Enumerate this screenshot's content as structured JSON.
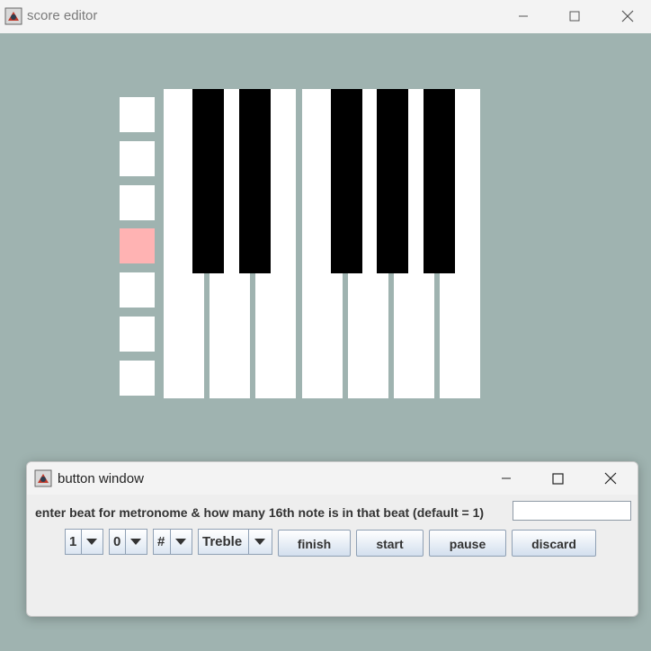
{
  "main_window": {
    "title": "score editor",
    "controls": [
      "minimize",
      "maximize",
      "close"
    ]
  },
  "editor": {
    "note_rows": [
      {
        "active": false
      },
      {
        "active": false
      },
      {
        "active": false
      },
      {
        "active": true
      },
      {
        "active": false
      },
      {
        "active": false
      },
      {
        "active": false
      }
    ],
    "colors": {
      "background": "#9fb3b0",
      "active_row": "#ffb3b3"
    },
    "piano": {
      "white_keys": 7,
      "black_keys": 5
    }
  },
  "dialog": {
    "title": "button window",
    "prompt": "enter beat for metronome & how many 16th note is in that beat (default = 1)",
    "beat_input": {
      "value": ""
    },
    "combos": [
      {
        "name": "beat-combo",
        "value": "1"
      },
      {
        "name": "count-combo",
        "value": "0"
      },
      {
        "name": "accidental-combo",
        "value": "#"
      },
      {
        "name": "clef-combo",
        "value": "Treble"
      }
    ],
    "buttons": {
      "finish": "finish",
      "start": "start",
      "pause": "pause",
      "discard": "discard"
    }
  }
}
